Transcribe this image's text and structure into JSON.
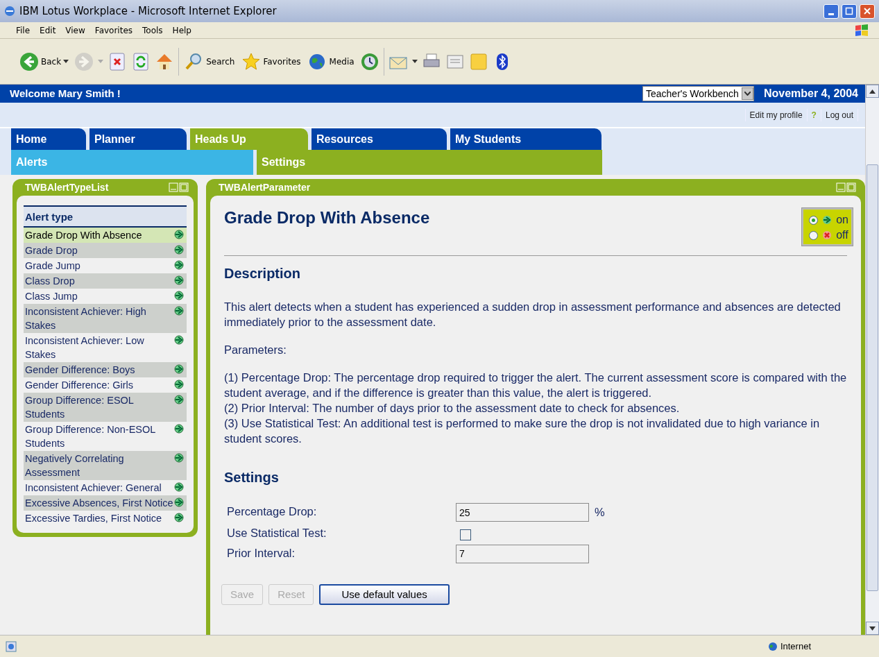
{
  "window": {
    "title": "IBM Lotus Workplace - Microsoft Internet Explorer"
  },
  "menu": [
    "File",
    "Edit",
    "View",
    "Favorites",
    "Tools",
    "Help"
  ],
  "toolbar": [
    {
      "kind": "back",
      "label": "Back",
      "dropdown": true
    },
    {
      "kind": "forward",
      "dropdown": true,
      "disabled": true
    },
    {
      "kind": "stop"
    },
    {
      "kind": "refresh"
    },
    {
      "kind": "home"
    },
    {
      "kind": "search",
      "label": "Search"
    },
    {
      "kind": "favorites",
      "label": "Favorites"
    },
    {
      "kind": "media",
      "label": "Media"
    },
    {
      "kind": "history"
    },
    {
      "kind": "mail",
      "dropdown": true
    },
    {
      "kind": "print"
    },
    {
      "kind": "edit"
    },
    {
      "kind": "note"
    },
    {
      "kind": "bluetooth"
    }
  ],
  "header": {
    "welcome": "Welcome Mary Smith !",
    "workbench": "Teacher's Workbench",
    "date": "November 4, 2004",
    "links": [
      {
        "kind": "link",
        "label": "Edit my profile"
      },
      {
        "kind": "help",
        "label": "?"
      },
      {
        "kind": "link",
        "label": "Log out"
      }
    ]
  },
  "tabs": [
    {
      "label": "Home",
      "selected": false
    },
    {
      "label": "Planner",
      "selected": false
    },
    {
      "label": "Heads Up",
      "selected": true
    },
    {
      "label": "Resources",
      "selected": false
    },
    {
      "label": "My Students",
      "selected": false
    }
  ],
  "subtabs": [
    {
      "label": "Alerts",
      "selected": true
    },
    {
      "label": "Settings",
      "selected": false
    }
  ],
  "alert_list": {
    "title": "TWBAlertTypeList",
    "heading": "Alert type",
    "items": [
      {
        "label": "Grade Drop With Absence",
        "selected": true
      },
      {
        "label": "Grade Drop",
        "selected": false
      },
      {
        "label": "Grade Jump",
        "selected": false
      },
      {
        "label": "Class Drop",
        "selected": false
      },
      {
        "label": "Class Jump",
        "selected": false
      },
      {
        "label": "Inconsistent Achiever: High Stakes",
        "selected": false
      },
      {
        "label": "Inconsistent Achiever: Low Stakes",
        "selected": false
      },
      {
        "label": "Gender Difference: Boys",
        "selected": false
      },
      {
        "label": "Gender Difference: Girls",
        "selected": false
      },
      {
        "label": "Group Difference: ESOL Students",
        "selected": false
      },
      {
        "label": "Group Difference: Non-ESOL Students",
        "selected": false
      },
      {
        "label": "Negatively Correlating Assessment",
        "selected": false
      },
      {
        "label": "Inconsistent Achiever: General",
        "selected": false
      },
      {
        "label": "Excessive Absences, First Notice",
        "selected": false
      },
      {
        "label": "Excessive Tardies, First Notice",
        "selected": false
      }
    ]
  },
  "parameters": {
    "title": "TWBAlertParameter",
    "alert_title": "Grade Drop With Absence",
    "switch": [
      {
        "label": "on",
        "selected": true
      },
      {
        "label": "off",
        "selected": false
      }
    ],
    "description_heading": "Description",
    "description": [
      "This alert detects when a student has experienced a sudden drop in assessment performance and absences are detected immediately prior to the assessment date.",
      "Parameters:"
    ],
    "parameter_lines": [
      "(1) Percentage Drop: The percentage drop required to trigger the alert. The current assessment score is compared with the student average, and if the difference is greater than this value, the alert is triggered.",
      "(2) Prior Interval: The number of days prior to the assessment date to check for absences.",
      "(3) Use Statistical Test: An additional test is performed to make sure the drop is not invalidated due to high variance in student scores."
    ],
    "settings_heading": "Settings",
    "settings": [
      {
        "kind": "text",
        "label": "Percentage Drop:",
        "value": "25",
        "unit": "%"
      },
      {
        "kind": "checkbox",
        "label": "Use Statistical Test:",
        "checked": false
      },
      {
        "kind": "text",
        "label": "Prior Interval:",
        "value": "7"
      }
    ],
    "buttons": [
      {
        "label": "Save",
        "disabled": true
      },
      {
        "label": "Reset",
        "disabled": true
      },
      {
        "label": "Use default values",
        "disabled": false
      }
    ]
  },
  "status_bar": {
    "zone": "Internet"
  }
}
